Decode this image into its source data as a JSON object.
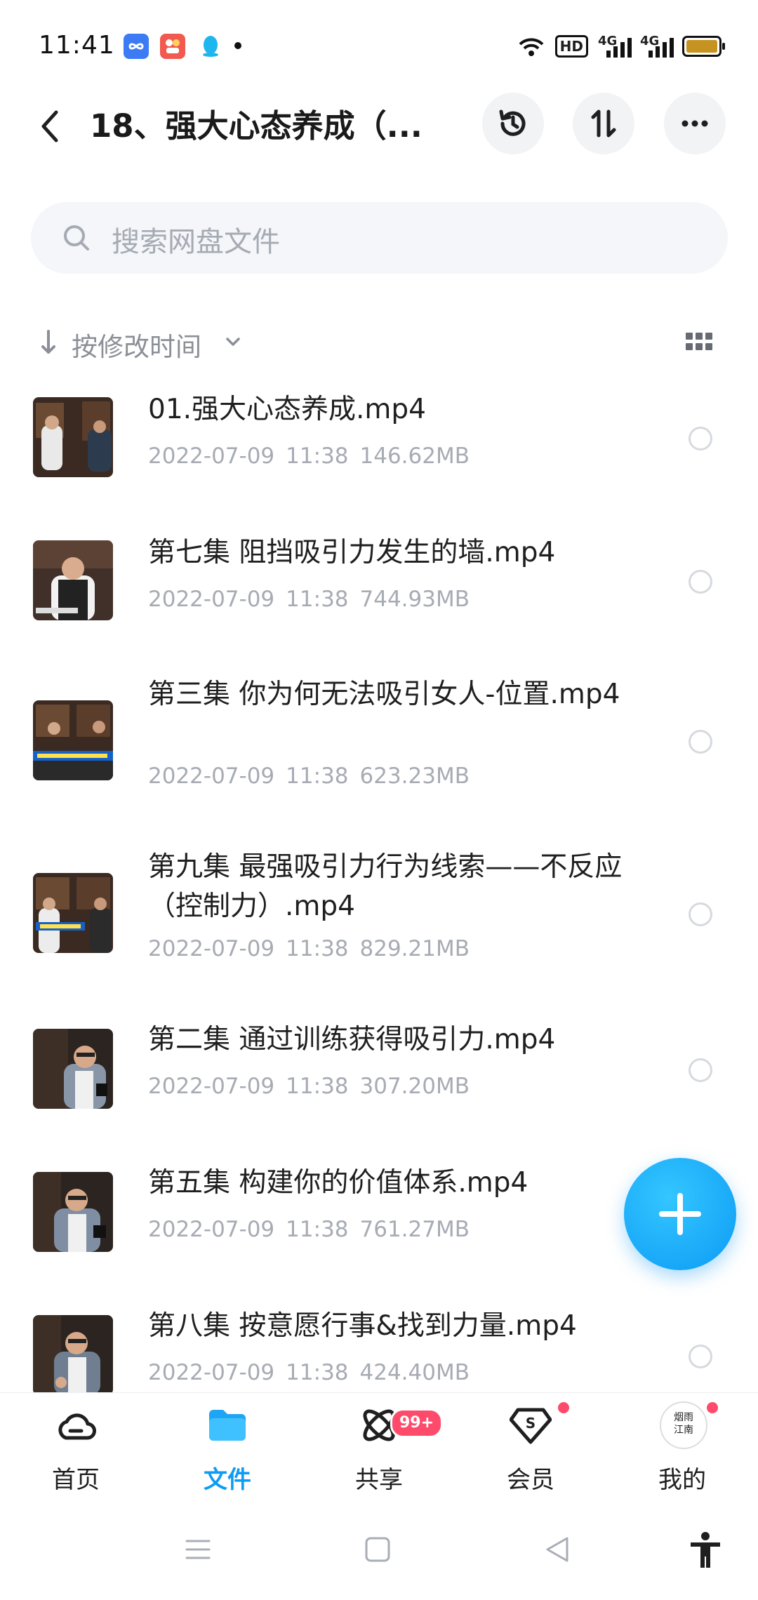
{
  "status_bar": {
    "time": "11:41",
    "hd_label": "HD",
    "signal_1": "4G",
    "signal_2": "4G",
    "battery_color": "#c69320"
  },
  "header": {
    "title": "18、强大心态养成（...",
    "back_icon": "chevron-left-icon",
    "history_icon": "history-icon",
    "sort_icon": "sort-updown-icon",
    "more_icon": "more-icon"
  },
  "search": {
    "placeholder": "搜索网盘文件"
  },
  "sort": {
    "label": "按修改时间"
  },
  "files": [
    {
      "name": "01.强大心态养成.mp4",
      "date": "2022-07-09",
      "time": "11:38",
      "size": "146.62MB"
    },
    {
      "name": "第七集 阻挡吸引力发生的墙.mp4",
      "date": "2022-07-09",
      "time": "11:38",
      "size": "744.93MB"
    },
    {
      "name": "第三集 你为何无法吸引女人-位置.mp4",
      "date": "2022-07-09",
      "time": "11:38",
      "size": "623.23MB"
    },
    {
      "name": "第九集 最强吸引力行为线索——不反应（控制力）.mp4",
      "date": "2022-07-09",
      "time": "11:38",
      "size": "829.21MB"
    },
    {
      "name": "第二集 通过训练获得吸引力.mp4",
      "date": "2022-07-09",
      "time": "11:38",
      "size": "307.20MB"
    },
    {
      "name": "第五集 构建你的价值体系.mp4",
      "date": "2022-07-09",
      "time": "11:38",
      "size": "761.27MB"
    },
    {
      "name": "第八集 按意愿行事&找到力量.mp4",
      "date": "2022-07-09",
      "time": "11:38",
      "size": "424.40MB"
    }
  ],
  "bottom_nav": {
    "home": "首页",
    "files": "文件",
    "share": "共享",
    "share_badge": "99+",
    "vip": "会员",
    "mine": "我的",
    "avatar_text": "烟雨江南",
    "active_color": "#0e9cf2"
  }
}
